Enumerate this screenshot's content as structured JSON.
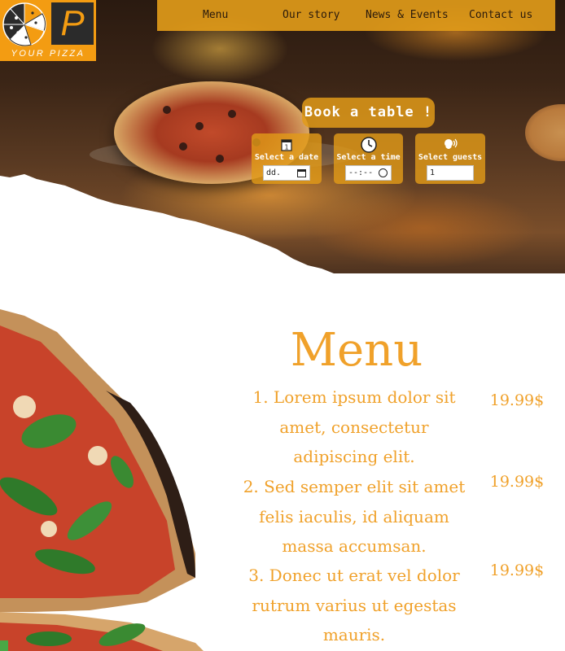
{
  "logo": {
    "letter": "P",
    "text": "YOUR PIZZA"
  },
  "nav": {
    "items": [
      {
        "label": "Menu"
      },
      {
        "label": "Our story"
      },
      {
        "label": "News & Events"
      },
      {
        "label": "Contact us"
      }
    ]
  },
  "booking": {
    "button_label": "Book a table !",
    "date": {
      "label": "Select a date",
      "value": "dd.",
      "icon": "calendar-icon"
    },
    "time": {
      "label": "Select a time",
      "value": "--:--",
      "icon": "clock-icon"
    },
    "guests": {
      "label": "Select guests",
      "value": "1",
      "icon": "guests-icon"
    }
  },
  "menu": {
    "title": "Menu",
    "items": [
      {
        "text": "1. Lorem ipsum dolor sit amet, consectetur adipiscing elit.",
        "price": "19.99$"
      },
      {
        "text": "2. Sed semper elit sit amet felis iaculis, id aliquam massa accumsan.",
        "price": "19.99$"
      },
      {
        "text": "3. Donec ut erat vel dolor rutrum varius ut egestas mauris.",
        "price": "19.99$"
      }
    ]
  },
  "colors": {
    "accent": "#f0a12a",
    "nav_bg": "#e09a19",
    "logo_bg": "#f39c12"
  }
}
